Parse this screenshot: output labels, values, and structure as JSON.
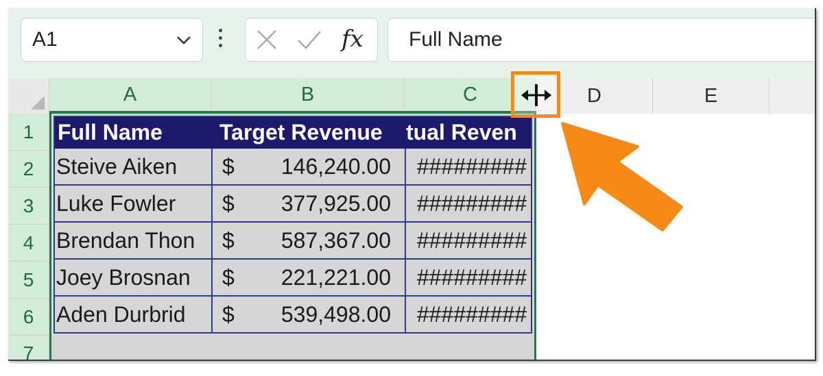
{
  "formula_bar": {
    "name_box": "A1",
    "fx_label": "fx",
    "formula_value": "Full Name"
  },
  "columns": [
    "A",
    "B",
    "C",
    "D",
    "E"
  ],
  "rows": [
    "1",
    "2",
    "3",
    "4",
    "5",
    "6",
    "7"
  ],
  "table": {
    "headers": [
      "Full Name",
      "Target Revenue",
      "tual Reven"
    ],
    "currency_symbol": "$",
    "rows": [
      {
        "name": "Steive Aiken",
        "target": "146,240.00",
        "actual": "#########"
      },
      {
        "name": "Luke Fowler",
        "target": "377,925.00",
        "actual": "#########"
      },
      {
        "name": "Brendan Thon",
        "target": "587,367.00",
        "actual": "#########"
      },
      {
        "name": "Joey Brosnan",
        "target": "221,221.00",
        "actual": "#########"
      },
      {
        "name": "Aden Durbrid",
        "target": "539,498.00",
        "actual": "#########"
      }
    ]
  },
  "colors": {
    "header_fill": "#1d1a6e",
    "selection_green": "#1f7a45",
    "highlight_orange": "#f58a14"
  },
  "icons": [
    "chevron-down-icon",
    "vertical-dots-icon",
    "cancel-x-icon",
    "confirm-check-icon",
    "resize-column-cursor-icon",
    "pointer-arrow-icon"
  ]
}
